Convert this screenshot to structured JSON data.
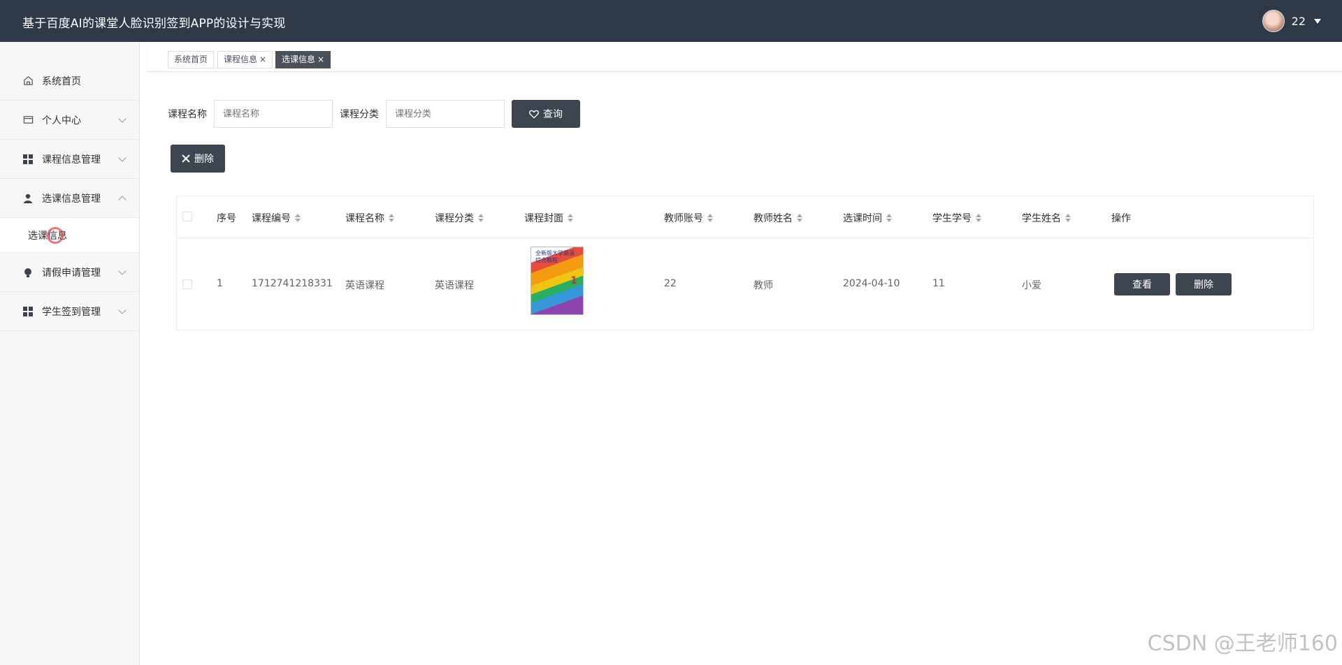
{
  "header": {
    "title": "基于百度AI的课堂人脸识别签到APP的设计与实现",
    "user_name": "22"
  },
  "sidebar": {
    "items": [
      {
        "label": "系统首页",
        "icon": "home-icon"
      },
      {
        "label": "个人中心",
        "icon": "card-icon"
      },
      {
        "label": "课程信息管理",
        "icon": "grid-icon"
      },
      {
        "label": "选课信息管理",
        "icon": "user-icon"
      },
      {
        "label": "请假申请管理",
        "icon": "bulb-icon"
      },
      {
        "label": "学生签到管理",
        "icon": "grid-icon"
      }
    ],
    "submenu_active": "选课信息"
  },
  "tags": [
    {
      "label": "系统首页"
    },
    {
      "label": "课程信息",
      "close": "×"
    },
    {
      "label": "选课信息",
      "close": "×"
    }
  ],
  "search": {
    "course_name_label": "课程名称",
    "course_name_placeholder": "课程名称",
    "course_category_label": "课程分类",
    "course_category_placeholder": "课程分类",
    "query_button": "查询",
    "delete_button": "删除"
  },
  "table": {
    "headers": [
      "序号",
      "课程编号",
      "课程名称",
      "课程分类",
      "课程封面",
      "教师账号",
      "教师姓名",
      "选课时间",
      "学生学号",
      "学生姓名",
      "操作"
    ],
    "rows": [
      {
        "index": "1",
        "course_id": "1712741218331",
        "course_name": "英语课程",
        "course_category": "英语课程",
        "cover_title": "全新版大学英语 综合教程",
        "cover_num": "1",
        "teacher_account": "22",
        "teacher_name": "教师",
        "select_time": "2024-04-10",
        "student_id": "11",
        "student_name": "小爱",
        "view_label": "查看",
        "delete_label": "删除"
      }
    ]
  },
  "watermark": "CSDN @王老师160",
  "colors": {
    "header_bg": "#2f3a48",
    "button_bg": "#3d4550",
    "active_tag_bg": "#4a505a"
  }
}
